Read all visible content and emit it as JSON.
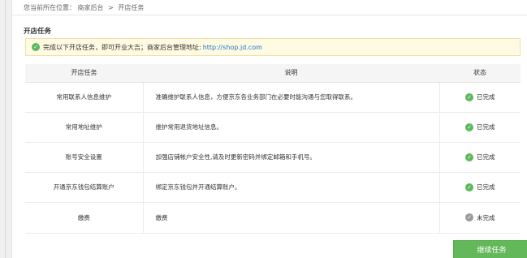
{
  "breadcrumb": {
    "prefix": "您当前所在位置：",
    "level1": "商家后台",
    "separator": ">",
    "level2": "开店任务"
  },
  "section_title": "开店任务",
  "notice": {
    "icon": "check-circle-icon",
    "text": "完成以下开店任务，即可开业大吉；商家后台管理地址:",
    "link": "http://shop.jd.com"
  },
  "table": {
    "headers": [
      "开店任务",
      "说明",
      "状态"
    ],
    "rows": [
      {
        "task": "常用联系人信息维护",
        "desc": "准确维护联系人信息，方便京东各业务部门在必要时能沟通与您取得联系。",
        "status": "已完成",
        "done": true
      },
      {
        "task": "常用地址维护",
        "desc": "维护常用退货地址信息。",
        "status": "已完成",
        "done": true
      },
      {
        "task": "账号安全设置",
        "desc": "加强店铺帐户安全性,请及时更新密码并绑定邮箱和手机号。",
        "status": "已完成",
        "done": true
      },
      {
        "task": "开通京东钱包结算账户",
        "desc": "绑定京东钱包并开通结算账户。",
        "status": "已完成",
        "done": true
      },
      {
        "task": "缴费",
        "desc": "缴费",
        "status": "未完成",
        "done": false
      }
    ]
  },
  "continue_button": "继续任务",
  "colors": {
    "done": "#5cb85c",
    "pending": "#9a9a9a",
    "button": "#63b85a",
    "notice_bg": "#fffbe3",
    "link": "#1a73c8"
  }
}
